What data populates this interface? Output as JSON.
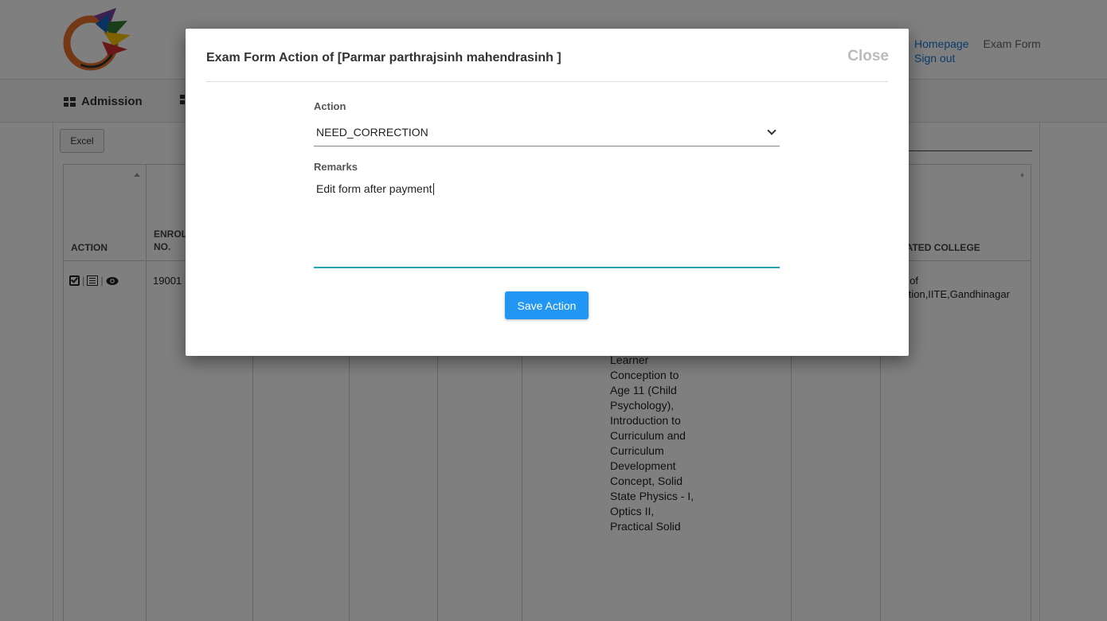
{
  "header": {
    "links": [
      "Homepage",
      "Exam Form"
    ],
    "signout": "Sign out"
  },
  "nav": {
    "admission": "Admission"
  },
  "toolbar": {
    "excel_label": "Excel"
  },
  "table": {
    "headers": {
      "action": "ACTION",
      "enrollment_line1": "ENROL",
      "enrollment_line2": "NO.",
      "affiliated_college": "LIATED COLLEGE"
    },
    "row": {
      "enrollment": "19001",
      "college_line1": "er of",
      "college_line2": "cation,IITE,Gandhinagar",
      "courses": "Meghdutam, Drama and Art in Education, Development of Learner Conception to Age 11 (Child Psychology), Introduction to Curriculum and Curriculum Development Concept, Solid State Physics - I, Optics II, Practical Solid"
    }
  },
  "modal": {
    "title": "Exam Form Action of [Parmar parthrajsinh mahendrasinh ]",
    "close_label": "Close",
    "action_label": "Action",
    "action_value": "NEED_CORRECTION",
    "remarks_label": "Remarks",
    "remarks_value": "Edit form after payment",
    "save_label": "Save Action"
  },
  "colors": {
    "primary": "#2196f3",
    "focus_underline": "#26a2b7",
    "overlay": "rgba(0,0,0,0.5)"
  }
}
